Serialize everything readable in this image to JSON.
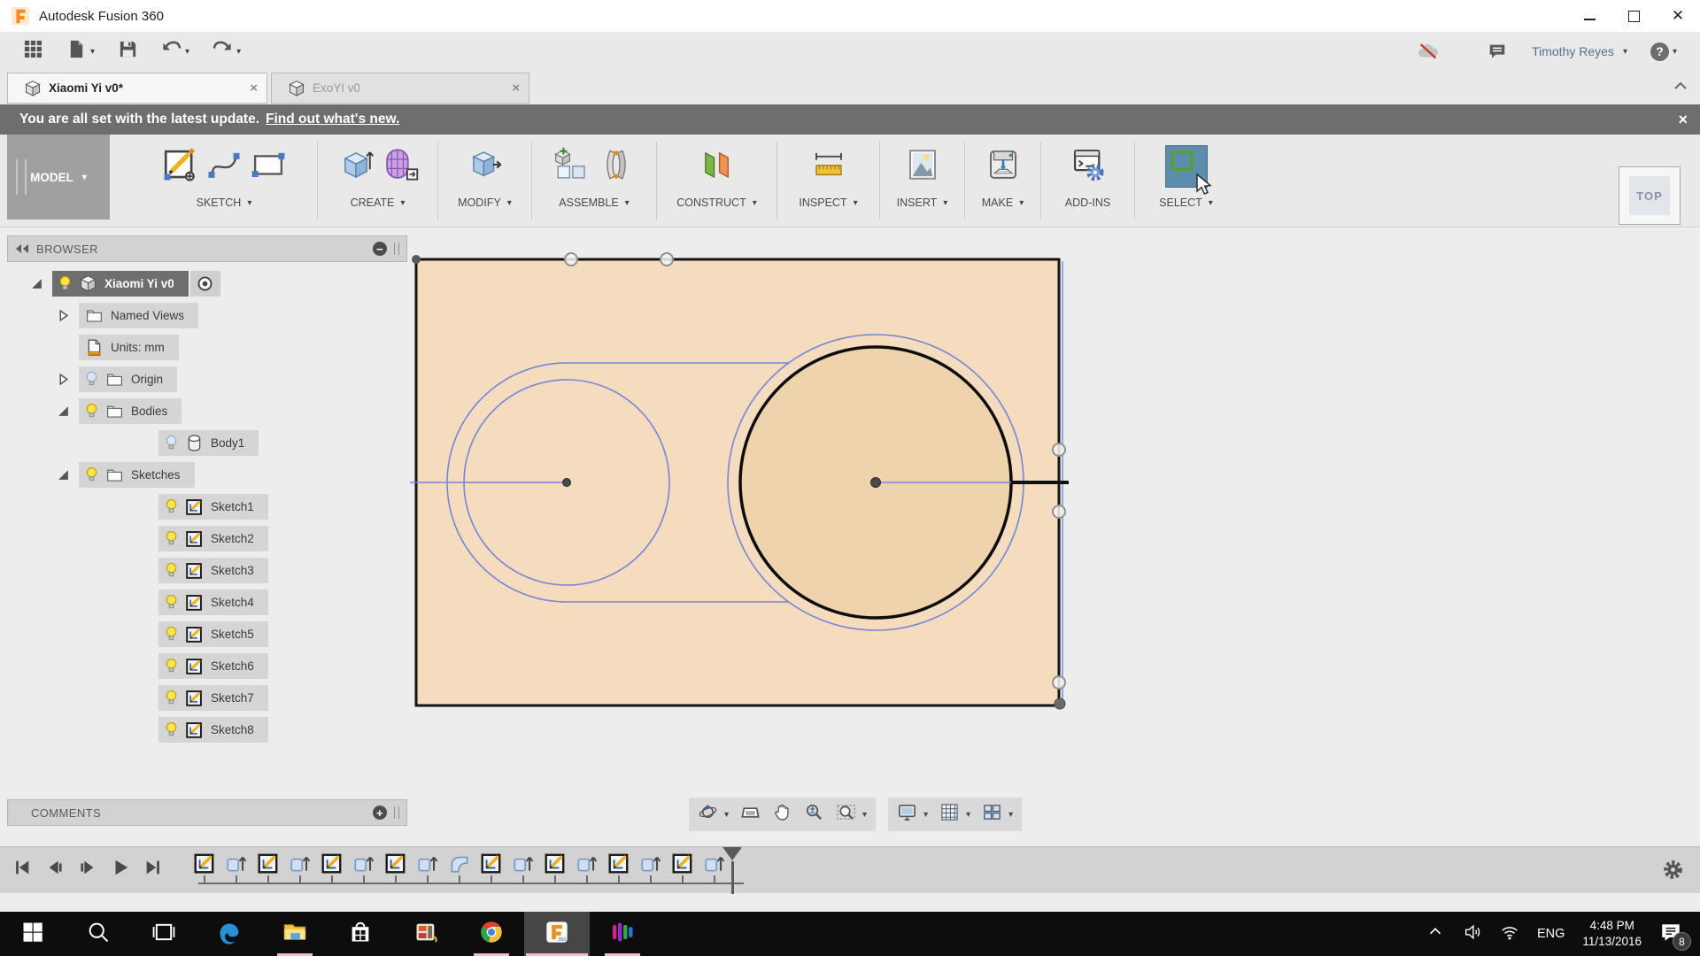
{
  "titlebar": {
    "app_title": "Autodesk Fusion 360"
  },
  "qat": {
    "left_icons": [
      {
        "icon": "app-grid",
        "caret": false
      },
      {
        "icon": "file-new",
        "caret": true
      },
      {
        "icon": "save",
        "caret": false
      },
      {
        "icon": "undo",
        "caret": true
      },
      {
        "icon": "redo",
        "caret": true
      }
    ],
    "offline_icon": "offline-cloud",
    "chat_icon": "chat",
    "user_name": "Timothy Reyes",
    "help_label": "?"
  },
  "tabs": [
    {
      "label": "Xiaomi Yi v0*",
      "active": true,
      "close_glyph": "×"
    },
    {
      "label": "ExoYI v0",
      "active": false,
      "close_glyph": "×"
    }
  ],
  "notification": {
    "message": "You are all set with the latest update.",
    "link_text": "Find out what's new.",
    "close_glyph": "×"
  },
  "ribbon": {
    "workspace_label": "MODEL",
    "groups": [
      {
        "label": "SKETCH",
        "caret": true,
        "icons": [
          "create-sketch",
          "spline",
          "rectangle"
        ]
      },
      {
        "label": "CREATE",
        "caret": true,
        "icons": [
          "extrude",
          "form"
        ]
      },
      {
        "label": "MODIFY",
        "caret": true,
        "icons": [
          "press-pull"
        ]
      },
      {
        "label": "ASSEMBLE",
        "caret": true,
        "icons": [
          "new-component",
          "joint"
        ]
      },
      {
        "label": "CONSTRUCT",
        "caret": true,
        "icons": [
          "construction-plane"
        ]
      },
      {
        "label": "INSPECT",
        "caret": true,
        "icons": [
          "measure"
        ]
      },
      {
        "label": "INSERT",
        "caret": true,
        "icons": [
          "insert-image"
        ]
      },
      {
        "label": "MAKE",
        "caret": true,
        "icons": [
          "3d-print"
        ]
      },
      {
        "label": "ADD-INS",
        "caret": false,
        "icons": [
          "scripts-addins"
        ]
      },
      {
        "label": "SELECT",
        "caret": true,
        "icons": [
          "select"
        ]
      }
    ]
  },
  "viewcube": {
    "face_label": "TOP"
  },
  "browser": {
    "header_title": "BROWSER",
    "rows": [
      {
        "label": "Xiaomi Yi v0",
        "icon": "component-cube",
        "bulb": "on",
        "expander": "expanded",
        "indent": 0,
        "selected": true,
        "radio": true
      },
      {
        "label": "Named Views",
        "icon": "folder",
        "bulb": null,
        "expander": "collapsed",
        "indent": 1
      },
      {
        "label": "Units: mm",
        "icon": "units-document",
        "bulb": null,
        "expander": null,
        "indent": 1
      },
      {
        "label": "Origin",
        "icon": "folder",
        "bulb": "off",
        "expander": "collapsed",
        "indent": 1
      },
      {
        "label": "Bodies",
        "icon": "folder",
        "bulb": "on",
        "expander": "expanded",
        "indent": 1
      },
      {
        "label": "Body1",
        "icon": "body-cylinder",
        "bulb": "off",
        "expander": null,
        "indent": 2
      },
      {
        "label": "Sketches",
        "icon": "folder",
        "bulb": "on",
        "expander": "expanded",
        "indent": 1
      },
      {
        "label": "Sketch1",
        "icon": "sketch",
        "bulb": "on",
        "expander": null,
        "indent": 2
      },
      {
        "label": "Sketch2",
        "icon": "sketch",
        "bulb": "on",
        "expander": null,
        "indent": 2
      },
      {
        "label": "Sketch3",
        "icon": "sketch",
        "bulb": "on",
        "expander": null,
        "indent": 2
      },
      {
        "label": "Sketch4",
        "icon": "sketch",
        "bulb": "on",
        "expander": null,
        "indent": 2
      },
      {
        "label": "Sketch5",
        "icon": "sketch",
        "bulb": "on",
        "expander": null,
        "indent": 2
      },
      {
        "label": "Sketch6",
        "icon": "sketch",
        "bulb": "on",
        "expander": null,
        "indent": 2
      },
      {
        "label": "Sketch7",
        "icon": "sketch",
        "bulb": "on",
        "expander": null,
        "indent": 2
      },
      {
        "label": "Sketch8",
        "icon": "sketch",
        "bulb": "on",
        "expander": null,
        "indent": 2
      }
    ]
  },
  "comments": {
    "header_title": "COMMENTS"
  },
  "navbar": {
    "groups": [
      [
        {
          "icon": "orbit",
          "caret": true
        },
        {
          "icon": "look-at",
          "caret": false
        },
        {
          "icon": "pan",
          "caret": false
        },
        {
          "icon": "zoom",
          "caret": false
        },
        {
          "icon": "fit",
          "caret": true
        }
      ],
      [
        {
          "icon": "display-settings",
          "caret": true
        },
        {
          "icon": "layout-grid",
          "caret": true
        },
        {
          "icon": "viewports",
          "caret": true
        }
      ]
    ]
  },
  "timeline": {
    "playback_icons": [
      "go-to-start",
      "step-back",
      "step-forward",
      "play",
      "go-to-end"
    ],
    "features": [
      "sketch",
      "extrude",
      "sketch",
      "extrude",
      "sketch",
      "extrude",
      "sketch",
      "extrude",
      "fillet",
      "sketch",
      "extrude",
      "sketch",
      "extrude",
      "sketch",
      "extrude",
      "sketch",
      "extrude"
    ],
    "gear_icon": "timeline-settings-gear"
  },
  "taskbar": {
    "apps": [
      {
        "icon": "windows-start",
        "running": false,
        "active": false
      },
      {
        "icon": "search",
        "running": false,
        "active": false
      },
      {
        "icon": "task-view",
        "running": false,
        "active": false
      },
      {
        "icon": "edge",
        "running": false,
        "active": false
      },
      {
        "icon": "file-explorer",
        "running": true,
        "active": false
      },
      {
        "icon": "windows-store",
        "running": false,
        "active": false
      },
      {
        "icon": "video-editor",
        "running": false,
        "active": false
      },
      {
        "icon": "chrome",
        "running": true,
        "active": false
      },
      {
        "icon": "fusion-360",
        "running": true,
        "active": true
      },
      {
        "icon": "media-app",
        "running": true,
        "active": false
      }
    ],
    "tray": {
      "language": "ENG",
      "time": "4:48 PM",
      "date": "11/13/2016",
      "notification_badge": "8",
      "icons": [
        "chevron-up",
        "volume",
        "wifi",
        "action-center"
      ]
    }
  },
  "colors": {
    "select_highlight_blue": "#5d8cad",
    "sketch_line_blue": "#7585d8",
    "sketch_fill": "#f6dcbe",
    "inner_circle_fill": "#efd3ac",
    "notification_bg": "#6e6e6e",
    "taskbar_indicator_pink": "#f2bcc8",
    "selected_row_gray": "#6e6e6e"
  }
}
